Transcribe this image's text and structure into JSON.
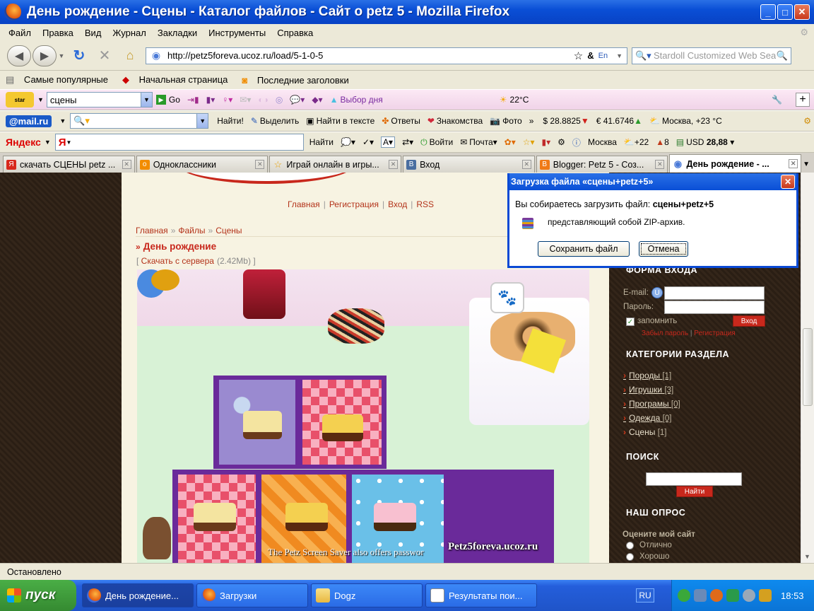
{
  "window": {
    "title": "День рождение - Сцены - Каталог файлов - Сайт о petz 5 - Mozilla Firefox"
  },
  "menu": [
    "Файл",
    "Правка",
    "Вид",
    "Журнал",
    "Закладки",
    "Инструменты",
    "Справка"
  ],
  "nav": {
    "url": "http://petz5foreva.ucoz.ru/load/5-1-0-5",
    "search_placeholder": "Stardoll Customized Web Sea"
  },
  "bookmarks": [
    "Самые популярные",
    "Начальная страница",
    "Последние заголовки"
  ],
  "toolbar1": {
    "query": "сцены",
    "go": "Go",
    "pick": "Выбор дня",
    "temp": "22°C"
  },
  "toolbar2": {
    "logo": "@mail.ru",
    "find": "Найти!",
    "highlight": "Выделить",
    "find_text": "Найти в тексте",
    "answers": "Ответы",
    "dating": "Знакомства",
    "photo": "Фото",
    "usd": "$ 28.8825",
    "eur": "€ 41.6746",
    "weather": "Москва, +23 °C"
  },
  "toolbar3": {
    "logo": "Яндекс",
    "query_icon": "Я",
    "find": "Найти",
    "login": "Войти",
    "mail": "Почта",
    "city": "Москва",
    "temp": "+22",
    "count": "8",
    "usd_label": "USD",
    "usd_value": "28,88"
  },
  "tabs": [
    {
      "label": "скачать СЦЕНЫ petz ...",
      "icon": "yandex-icon",
      "color": "#d8281c"
    },
    {
      "label": "Одноклассники",
      "icon": "odnoklassniki-icon",
      "color": "#f28c00"
    },
    {
      "label": "Играй онлайн в игры...",
      "icon": "star-icon",
      "color": "#e8c000"
    },
    {
      "label": "Вход",
      "icon": "vk-icon",
      "color": "#4a6ea0"
    },
    {
      "label": "Blogger: Petz 5 - Соз...",
      "icon": "blogger-icon",
      "color": "#f07a16"
    },
    {
      "label": "День рождение - ...",
      "icon": "ucoz-icon",
      "color": "#4a7ad8"
    }
  ],
  "site": {
    "top_links": [
      "Главная",
      "Регистрация",
      "Вход",
      "RSS"
    ],
    "breadcrumb": [
      "Главная",
      "Файлы",
      "Сцены"
    ],
    "sep": "»",
    "title": "День рождение",
    "download": "Скачать с сервера",
    "size": "(2.42Mb)",
    "scene_caption": "The Petz Screen Saver also offers passwor",
    "watermark": "Petz5foreva.ucoz.ru"
  },
  "sidebar": {
    "login_title": "ФОРМА ВХОДА",
    "email_label": "E-mail:",
    "pass_label": "Пароль:",
    "remember": "запомнить",
    "login_btn": "Вход",
    "forgot": "Забыл пароль",
    "register": "Регистрация",
    "cat_title": "КАТЕГОРИИ РАЗДЕЛА",
    "categories": [
      {
        "name": "Породы",
        "count": "[1]"
      },
      {
        "name": "Игрушки",
        "count": "[3]"
      },
      {
        "name": "Програмы",
        "count": "[0]"
      },
      {
        "name": "Одежда",
        "count": "[0]"
      },
      {
        "name": "Сцены",
        "count": "[1]"
      }
    ],
    "search_title": "ПОИСК",
    "search_btn": "Найти",
    "poll_title": "НАШ ОПРОС",
    "poll_q": "Оцените мой сайт",
    "poll_opts": [
      "Отлично",
      "Хорошо"
    ]
  },
  "dialog": {
    "title": "Загрузка файла «сцены+petz+5»",
    "msg_prefix": "Вы собираетесь загрузить файл:",
    "filename": "сцены+petz+5",
    "type": "представляющий собой ZIP-архив.",
    "save": "Сохранить файл",
    "cancel": "Отмена"
  },
  "status": "Остановлено",
  "taskbar": {
    "start": "пуск",
    "tasks": [
      "День рождение...",
      "Загрузки",
      "Dogz",
      "Результаты пои..."
    ],
    "lang": "RU",
    "clock": "18:53"
  }
}
